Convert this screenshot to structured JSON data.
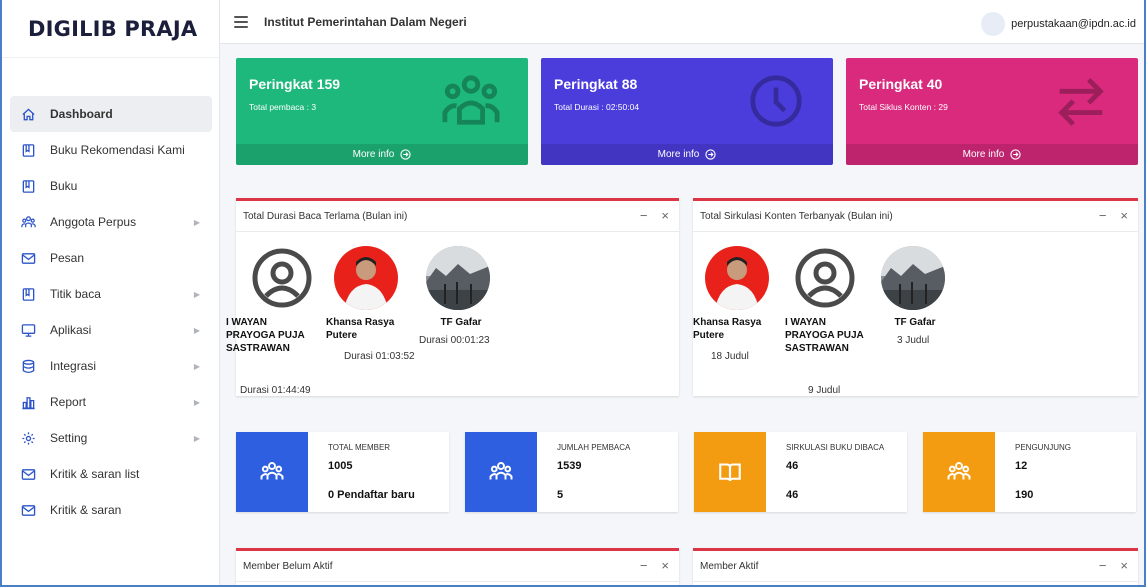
{
  "brand": "DIGILIB PRAJA",
  "header": {
    "institution": "Institut Pemerintahan Dalam Negeri",
    "user_email": "perpustakaan@ipdn.ac.id"
  },
  "sidebar": {
    "items": [
      {
        "label": "Dashboard",
        "icon": "home-icon",
        "active": true,
        "caret": false
      },
      {
        "label": "Buku Rekomendasi Kami",
        "icon": "book-icon",
        "caret": false
      },
      {
        "label": "Buku",
        "icon": "book-icon",
        "caret": false
      },
      {
        "label": "Anggota Perpus",
        "icon": "users-icon",
        "caret": true
      },
      {
        "label": "Pesan",
        "icon": "mail-icon",
        "caret": false
      },
      {
        "label": "Titik baca",
        "icon": "book-icon",
        "caret": true
      },
      {
        "label": "Aplikasi",
        "icon": "monitor-icon",
        "caret": true
      },
      {
        "label": "Integrasi",
        "icon": "database-icon",
        "caret": true
      },
      {
        "label": "Report",
        "icon": "chart-icon",
        "caret": true
      },
      {
        "label": "Setting",
        "icon": "gear-icon",
        "caret": true
      },
      {
        "label": "Kritik & saran list",
        "icon": "mail-icon",
        "caret": false
      },
      {
        "label": "Kritik & saran",
        "icon": "mail-icon",
        "caret": false
      }
    ]
  },
  "stats": [
    {
      "title": "Peringkat 159",
      "sub": "Total pembaca : 3",
      "more": "More info",
      "color": "#1fb87c",
      "icon": "users-icon"
    },
    {
      "title": "Peringkat 88",
      "sub": "Total Durasi : 02:50:04",
      "more": "More info",
      "color": "#4b3ddc",
      "icon": "clock-icon"
    },
    {
      "title": "Peringkat 40",
      "sub": "Total Siklus Konten : 29",
      "more": "More info",
      "color": "#d92a7e",
      "icon": "exchange-icon"
    }
  ],
  "cards": {
    "durasi": {
      "title": "Total Durasi Baca Terlama (Bulan ini)",
      "people": [
        {
          "name": "I WAYAN PRAYOGA PUJA SASTRAWAN",
          "value": "Durasi 01:44:49",
          "avatar": "default"
        },
        {
          "name": "Khansa Rasya Putere",
          "value": "Durasi 01:03:52",
          "avatar": "photo-red"
        },
        {
          "name": "TF Gafar",
          "value": "Durasi 00:01:23",
          "avatar": "photo-landscape"
        }
      ]
    },
    "sirkulasi": {
      "title": "Total Sirkulasi Konten Terbanyak (Bulan ini)",
      "people": [
        {
          "name": "Khansa Rasya Putere",
          "value": "18 Judul",
          "avatar": "photo-red"
        },
        {
          "name": "I WAYAN PRAYOGA PUJA SASTRAWAN",
          "value": "9 Judul",
          "avatar": "default"
        },
        {
          "name": "TF Gafar",
          "value": "3 Judul",
          "avatar": "photo-landscape"
        }
      ]
    },
    "belum_aktif": {
      "title": "Member Belum Aktif"
    },
    "aktif": {
      "title": "Member Aktif"
    },
    "minimize": "−",
    "close": "×"
  },
  "infos": [
    {
      "label": "TOTAL MEMBER",
      "value1": "1005",
      "value2": "0 Pendaftar baru",
      "color": "#2d5fe0",
      "icon": "users-icon"
    },
    {
      "label": "JUMLAH PEMBACA",
      "value1": "1539",
      "value2": "5",
      "color": "#2d5fe0",
      "icon": "users-icon"
    },
    {
      "label": "SIRKULASI BUKU DIBACA",
      "value1": "46",
      "value2": "46",
      "color": "#f39c12",
      "icon": "book-icon"
    },
    {
      "label": "PENGUNJUNG",
      "value1": "12",
      "value2": "190",
      "color": "#f39c12",
      "icon": "users-icon"
    }
  ]
}
